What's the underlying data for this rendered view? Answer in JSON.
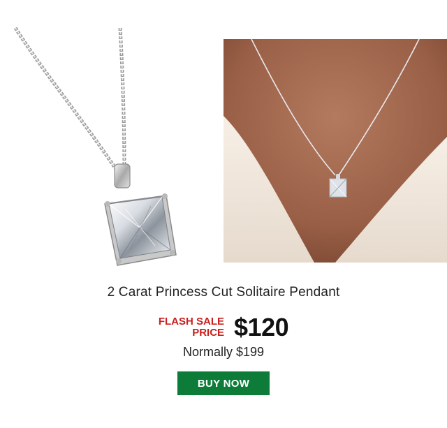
{
  "product": {
    "title": "2 Carat Princess Cut Solitaire Pendant",
    "sale_label_line1": "FLASH SALE",
    "sale_label_line2": "PRICE",
    "sale_price": "$120",
    "normal_price": "Normally $199",
    "buy_label": "BUY NOW"
  },
  "colors": {
    "sale_red": "#c8201e",
    "button_green": "#0c7c38"
  }
}
